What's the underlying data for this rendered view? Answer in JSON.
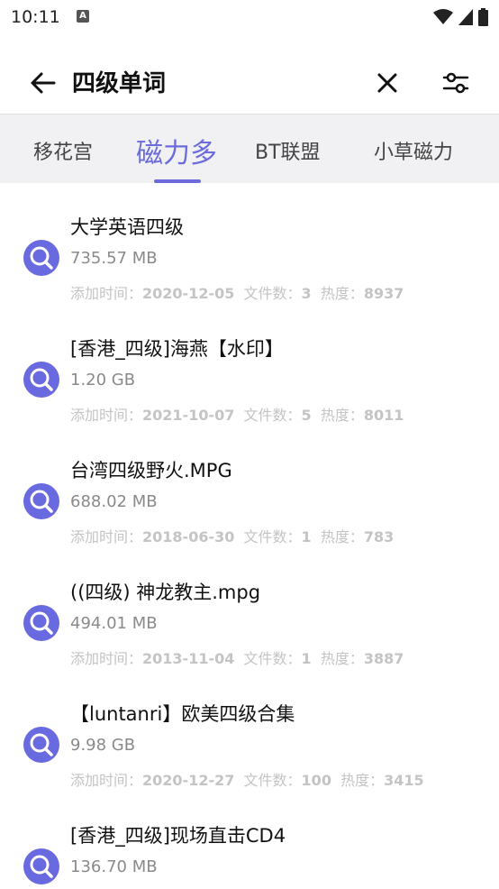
{
  "status": {
    "time": "10:11",
    "notif_icon": "A"
  },
  "app_bar": {
    "title": "四级单词"
  },
  "tabs": [
    {
      "label": "移花宫",
      "active": false
    },
    {
      "label": "磁力多",
      "active": true
    },
    {
      "label": "BT联盟",
      "active": false
    },
    {
      "label": "小草磁力",
      "active": false
    }
  ],
  "meta_labels": {
    "time": "添加时间：",
    "files": "文件数：",
    "heat": "热度："
  },
  "results": [
    {
      "title": "大学英语四级",
      "size": "735.57 MB",
      "date": "2020-12-05",
      "files": "3",
      "heat": "8937"
    },
    {
      "title": "[香港_四级]海燕【水印】",
      "size": "1.20 GB",
      "date": "2021-10-07",
      "files": "5",
      "heat": "8011"
    },
    {
      "title": "台湾四级野火.MPG",
      "size": "688.02 MB",
      "date": "2018-06-30",
      "files": "1",
      "heat": "783"
    },
    {
      "title": "((四级) 神龙教主.mpg",
      "size": "494.01 MB",
      "date": "2013-11-04",
      "files": "1",
      "heat": "3887"
    },
    {
      "title": "【luntanri】欧美四级合集",
      "size": "9.98 GB",
      "date": "2020-12-27",
      "files": "100",
      "heat": "3415"
    },
    {
      "title": "[香港_四级]现场直击CD4",
      "size": "136.70 MB",
      "date": "",
      "files": "",
      "heat": ""
    }
  ],
  "colors": {
    "accent": "#6b6bdc",
    "icon_bg": "#6a6ae0"
  }
}
